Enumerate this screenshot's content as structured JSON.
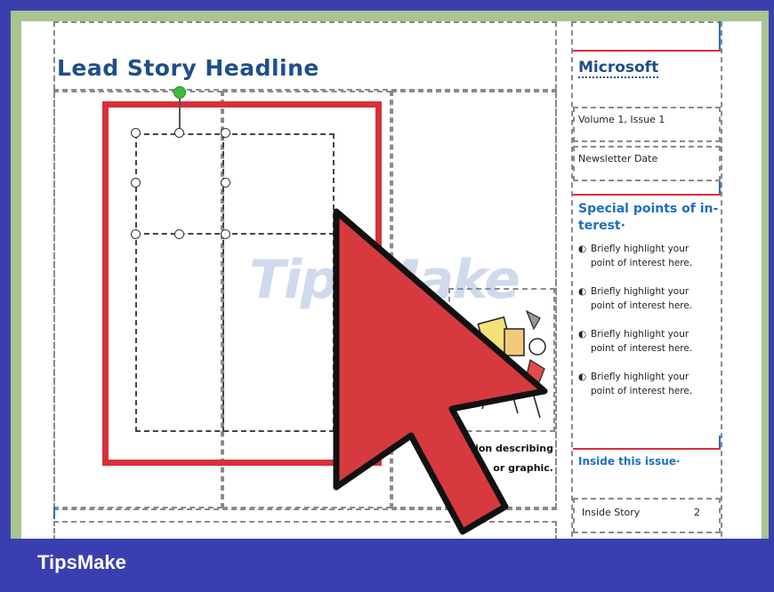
{
  "document": {
    "headline": "Lead Story Headline",
    "caption_line1": "ion describing",
    "caption_line2": "or graphic."
  },
  "sidebar": {
    "org_name": "Microsoft",
    "volume": "Volume 1, Issue 1",
    "date": "Newsletter Date",
    "special_title_1": "Special points of in-",
    "special_title_2": "terest·",
    "bullets": [
      {
        "l1": "Briefly highlight your",
        "l2": "point of interest here."
      },
      {
        "l1": "Briefly highlight your",
        "l2": "point of interest here."
      },
      {
        "l1": "Briefly highlight your",
        "l2": "point of interest here."
      },
      {
        "l1": "Briefly highlight your",
        "l2": "point of interest here."
      }
    ],
    "inside_title": "Inside this issue·",
    "inside_item": "Inside Story",
    "inside_page": "2"
  },
  "watermark": "TipsMake",
  "footer": {
    "brand": "TipsMake"
  },
  "colors": {
    "frame": "#3a3fb0",
    "border_green": "#a9c490",
    "accent_red": "#d8303a",
    "heading_blue": "#1f4e8a"
  },
  "icons": {
    "cursor": "arrow-cursor-icon",
    "rotate_handle": "rotate-handle-icon",
    "clipart": "clipart-image"
  }
}
